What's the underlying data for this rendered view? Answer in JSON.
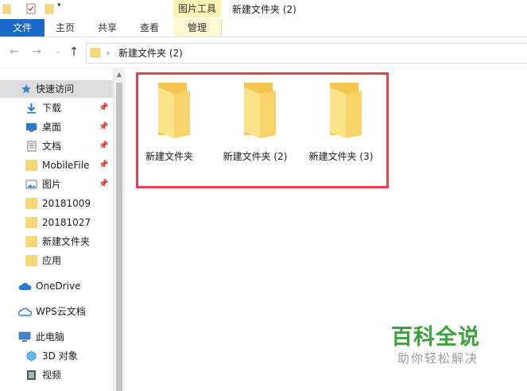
{
  "titlebar": {
    "context_tab": "图片工具",
    "window_title": "新建文件夹 (2)"
  },
  "ribbon": {
    "tabs": [
      "文件",
      "主页",
      "共享",
      "查看",
      "管理"
    ]
  },
  "address": {
    "path": "新建文件夹 (2)"
  },
  "sidebar": {
    "quick_access": "快速访问",
    "items": [
      {
        "label": "下载",
        "icon": "download-icon",
        "pinned": true
      },
      {
        "label": "桌面",
        "icon": "desktop-icon",
        "pinned": true
      },
      {
        "label": "文档",
        "icon": "document-icon",
        "pinned": true
      },
      {
        "label": "MobileFile",
        "icon": "folder-icon",
        "pinned": true
      },
      {
        "label": "图片",
        "icon": "pictures-icon",
        "pinned": true
      },
      {
        "label": "20181009",
        "icon": "folder-icon",
        "pinned": false
      },
      {
        "label": "20181027",
        "icon": "folder-icon",
        "pinned": false
      },
      {
        "label": "新建文件夹",
        "icon": "folder-icon",
        "pinned": false
      },
      {
        "label": "应用",
        "icon": "folder-icon",
        "pinned": false
      }
    ],
    "onedrive": "OneDrive",
    "wps": "WPS云文档",
    "this_pc": "此电脑",
    "pc_items": [
      "3D 对象",
      "视频"
    ]
  },
  "content": {
    "folders": [
      "新建文件夹",
      "新建文件夹 (2)",
      "新建文件夹 (3)"
    ]
  },
  "watermark": {
    "logo": "百科全说",
    "sub": "助你轻松解决"
  },
  "colors": {
    "accent": "#1b6ac9",
    "folder": "#f9d977",
    "highlight": "#e1444b",
    "watermark": "#3aa33a"
  }
}
